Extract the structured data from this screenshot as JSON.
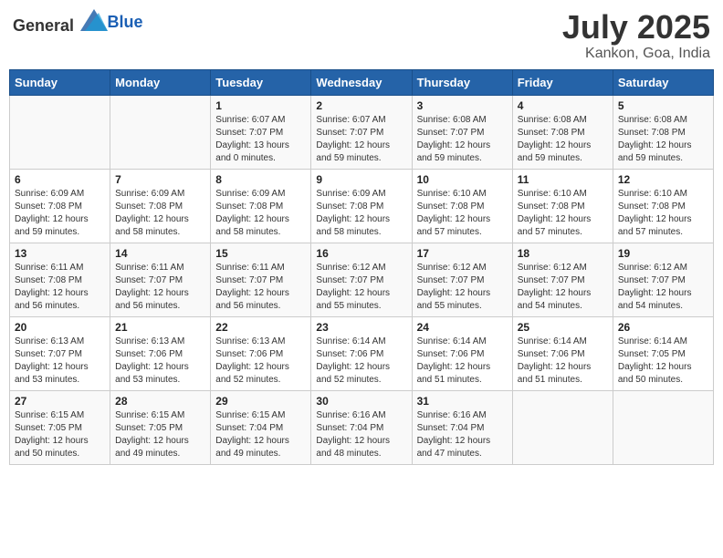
{
  "header": {
    "logo_general": "General",
    "logo_blue": "Blue",
    "month": "July 2025",
    "location": "Kankon, Goa, India"
  },
  "days_of_week": [
    "Sunday",
    "Monday",
    "Tuesday",
    "Wednesday",
    "Thursday",
    "Friday",
    "Saturday"
  ],
  "weeks": [
    [
      {
        "day": "",
        "info": ""
      },
      {
        "day": "",
        "info": ""
      },
      {
        "day": "1",
        "info": "Sunrise: 6:07 AM\nSunset: 7:07 PM\nDaylight: 13 hours\nand 0 minutes."
      },
      {
        "day": "2",
        "info": "Sunrise: 6:07 AM\nSunset: 7:07 PM\nDaylight: 12 hours\nand 59 minutes."
      },
      {
        "day": "3",
        "info": "Sunrise: 6:08 AM\nSunset: 7:07 PM\nDaylight: 12 hours\nand 59 minutes."
      },
      {
        "day": "4",
        "info": "Sunrise: 6:08 AM\nSunset: 7:08 PM\nDaylight: 12 hours\nand 59 minutes."
      },
      {
        "day": "5",
        "info": "Sunrise: 6:08 AM\nSunset: 7:08 PM\nDaylight: 12 hours\nand 59 minutes."
      }
    ],
    [
      {
        "day": "6",
        "info": "Sunrise: 6:09 AM\nSunset: 7:08 PM\nDaylight: 12 hours\nand 59 minutes."
      },
      {
        "day": "7",
        "info": "Sunrise: 6:09 AM\nSunset: 7:08 PM\nDaylight: 12 hours\nand 58 minutes."
      },
      {
        "day": "8",
        "info": "Sunrise: 6:09 AM\nSunset: 7:08 PM\nDaylight: 12 hours\nand 58 minutes."
      },
      {
        "day": "9",
        "info": "Sunrise: 6:09 AM\nSunset: 7:08 PM\nDaylight: 12 hours\nand 58 minutes."
      },
      {
        "day": "10",
        "info": "Sunrise: 6:10 AM\nSunset: 7:08 PM\nDaylight: 12 hours\nand 57 minutes."
      },
      {
        "day": "11",
        "info": "Sunrise: 6:10 AM\nSunset: 7:08 PM\nDaylight: 12 hours\nand 57 minutes."
      },
      {
        "day": "12",
        "info": "Sunrise: 6:10 AM\nSunset: 7:08 PM\nDaylight: 12 hours\nand 57 minutes."
      }
    ],
    [
      {
        "day": "13",
        "info": "Sunrise: 6:11 AM\nSunset: 7:08 PM\nDaylight: 12 hours\nand 56 minutes."
      },
      {
        "day": "14",
        "info": "Sunrise: 6:11 AM\nSunset: 7:07 PM\nDaylight: 12 hours\nand 56 minutes."
      },
      {
        "day": "15",
        "info": "Sunrise: 6:11 AM\nSunset: 7:07 PM\nDaylight: 12 hours\nand 56 minutes."
      },
      {
        "day": "16",
        "info": "Sunrise: 6:12 AM\nSunset: 7:07 PM\nDaylight: 12 hours\nand 55 minutes."
      },
      {
        "day": "17",
        "info": "Sunrise: 6:12 AM\nSunset: 7:07 PM\nDaylight: 12 hours\nand 55 minutes."
      },
      {
        "day": "18",
        "info": "Sunrise: 6:12 AM\nSunset: 7:07 PM\nDaylight: 12 hours\nand 54 minutes."
      },
      {
        "day": "19",
        "info": "Sunrise: 6:12 AM\nSunset: 7:07 PM\nDaylight: 12 hours\nand 54 minutes."
      }
    ],
    [
      {
        "day": "20",
        "info": "Sunrise: 6:13 AM\nSunset: 7:07 PM\nDaylight: 12 hours\nand 53 minutes."
      },
      {
        "day": "21",
        "info": "Sunrise: 6:13 AM\nSunset: 7:06 PM\nDaylight: 12 hours\nand 53 minutes."
      },
      {
        "day": "22",
        "info": "Sunrise: 6:13 AM\nSunset: 7:06 PM\nDaylight: 12 hours\nand 52 minutes."
      },
      {
        "day": "23",
        "info": "Sunrise: 6:14 AM\nSunset: 7:06 PM\nDaylight: 12 hours\nand 52 minutes."
      },
      {
        "day": "24",
        "info": "Sunrise: 6:14 AM\nSunset: 7:06 PM\nDaylight: 12 hours\nand 51 minutes."
      },
      {
        "day": "25",
        "info": "Sunrise: 6:14 AM\nSunset: 7:06 PM\nDaylight: 12 hours\nand 51 minutes."
      },
      {
        "day": "26",
        "info": "Sunrise: 6:14 AM\nSunset: 7:05 PM\nDaylight: 12 hours\nand 50 minutes."
      }
    ],
    [
      {
        "day": "27",
        "info": "Sunrise: 6:15 AM\nSunset: 7:05 PM\nDaylight: 12 hours\nand 50 minutes."
      },
      {
        "day": "28",
        "info": "Sunrise: 6:15 AM\nSunset: 7:05 PM\nDaylight: 12 hours\nand 49 minutes."
      },
      {
        "day": "29",
        "info": "Sunrise: 6:15 AM\nSunset: 7:04 PM\nDaylight: 12 hours\nand 49 minutes."
      },
      {
        "day": "30",
        "info": "Sunrise: 6:16 AM\nSunset: 7:04 PM\nDaylight: 12 hours\nand 48 minutes."
      },
      {
        "day": "31",
        "info": "Sunrise: 6:16 AM\nSunset: 7:04 PM\nDaylight: 12 hours\nand 47 minutes."
      },
      {
        "day": "",
        "info": ""
      },
      {
        "day": "",
        "info": ""
      }
    ]
  ]
}
